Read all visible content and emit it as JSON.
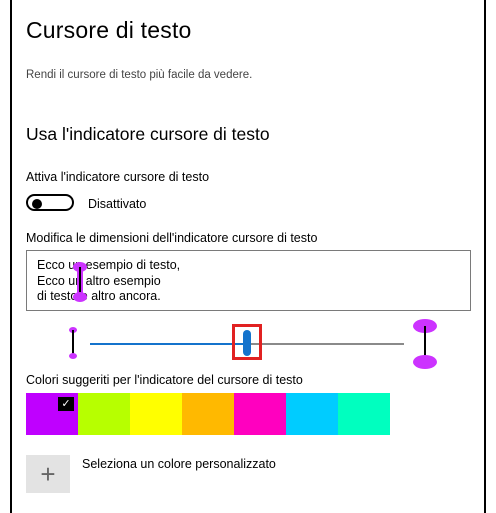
{
  "page": {
    "title": "Cursore di testo",
    "subtitle": "Rendi il cursore di testo più facile da vedere."
  },
  "indicator": {
    "section_title": "Usa l'indicatore cursore di testo",
    "toggle_label": "Attiva l'indicatore cursore di testo",
    "toggle_state": "Disattivato",
    "toggle_on": false
  },
  "size": {
    "label": "Modifica le dimensioni dell'indicatore cursore di testo",
    "preview_lines": [
      "Ecco un esempio di testo,",
      "Ecco un altro esempio",
      "di testo e altro ancora."
    ],
    "slider_fraction": 0.5,
    "indicator_color": "#cc33ff"
  },
  "colors": {
    "label": "Colori suggeriti per l'indicatore del cursore di testo",
    "swatches": [
      {
        "name": "swatch-purple",
        "color": "#bf00ff",
        "selected": true
      },
      {
        "name": "swatch-lime",
        "color": "#b7ff00",
        "selected": false
      },
      {
        "name": "swatch-yellow",
        "color": "#ffff00",
        "selected": false
      },
      {
        "name": "swatch-orange",
        "color": "#ffb900",
        "selected": false
      },
      {
        "name": "swatch-magenta",
        "color": "#ff00bf",
        "selected": false
      },
      {
        "name": "swatch-cyan",
        "color": "#00ccff",
        "selected": false
      },
      {
        "name": "swatch-teal",
        "color": "#00ffbf",
        "selected": false
      }
    ],
    "check_icon": "checkmark-icon"
  },
  "custom_color": {
    "label": "Seleziona un colore personalizzato",
    "icon": "plus-icon"
  }
}
